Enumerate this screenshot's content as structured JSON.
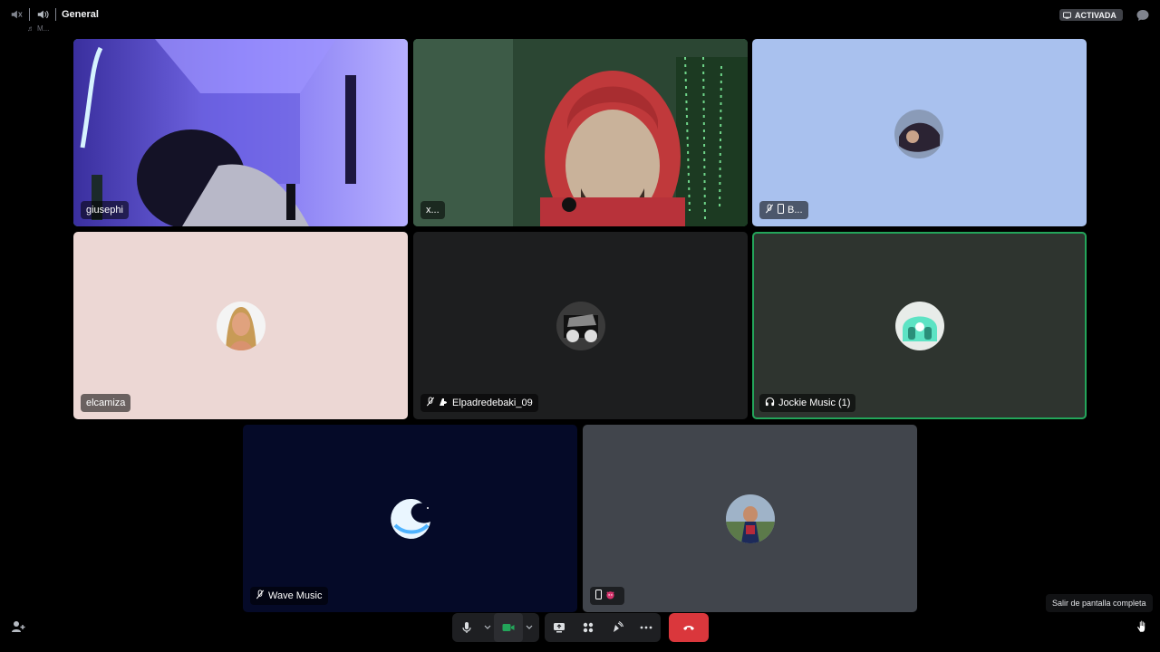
{
  "top_bar": {
    "channel_name": "General",
    "sub_status": "M...",
    "activity_badge": "ACTIVADA"
  },
  "tiles": [
    {
      "name": "giusephi",
      "kind": "video",
      "speaking": true
    },
    {
      "name": "x...",
      "kind": "video",
      "speaking": true
    },
    {
      "name": "B...",
      "kind": "avatar",
      "speaking": false,
      "icons": [
        "muted-mic-icon",
        "mobile-icon"
      ]
    },
    {
      "name": "elcamiza",
      "kind": "avatar",
      "speaking": false
    },
    {
      "name": "Elpadredebaki_09",
      "kind": "avatar",
      "speaking": false,
      "icons": [
        "muted-mic-icon",
        "console-icon"
      ]
    },
    {
      "name": "Jockie Music (1)",
      "kind": "avatar",
      "speaking": true,
      "icons": [
        "headphones-icon"
      ]
    },
    {
      "name": "Wave Music",
      "kind": "avatar",
      "speaking": false,
      "icons": [
        "muted-mic-icon"
      ]
    },
    {
      "name": "",
      "kind": "avatar",
      "speaking": false,
      "icons": [
        "mobile-icon",
        "devil-emoji-icon"
      ]
    }
  ],
  "controls": {
    "mic": "microphone-icon",
    "camera": "camera-icon",
    "share_screen": "screen-share-icon",
    "activities": "activities-icon",
    "soundboard": "soundboard-icon",
    "more": "more-icon",
    "hang_up": "hang-up-icon"
  },
  "tooltip": {
    "text": "Salir de pantalla completa"
  },
  "colors": {
    "background": "#000000",
    "speaking_border": "#23a55a",
    "hang_up": "#da373c",
    "camera_active": "#23a55a"
  }
}
